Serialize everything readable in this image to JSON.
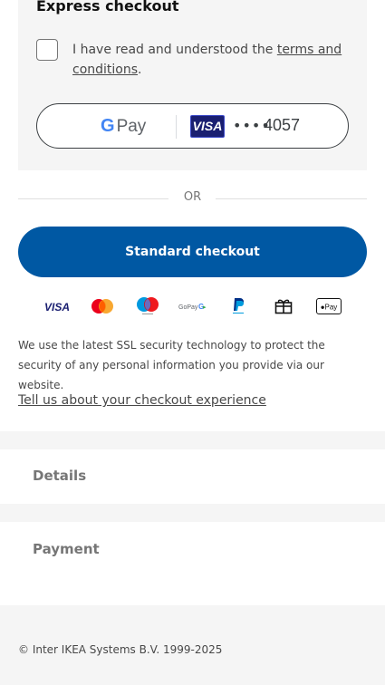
{
  "express": {
    "title": "Express checkout",
    "terms_prefix": "I have read and understood the ",
    "terms_link": "terms and conditions",
    "terms_suffix": ".",
    "gpay": {
      "g": "G",
      "pay": "Pay",
      "card_brand": "VISA",
      "masked": "••••",
      "last4": "4057"
    }
  },
  "divider": {
    "or_label": "OR"
  },
  "standard_checkout_label": "Standard checkout",
  "payment_methods": [
    "visa-icon",
    "mastercard-icon",
    "maestro-icon",
    "gopay-icon",
    "paypal-icon",
    "gift-card-icon",
    "apple-pay-icon"
  ],
  "security_text": "We use the latest SSL security technology to protect the security of any personal information you provide via our website.",
  "feedback_link": "Tell us about your checkout experience",
  "sections": {
    "details": "Details",
    "payment": "Payment"
  },
  "footer": {
    "copyright": "© Inter IKEA Systems B.V. 1999-2025"
  },
  "colors": {
    "primary": "#0058a3",
    "panel": "#f5f5f5",
    "visa_blue": "#1a1f71"
  }
}
